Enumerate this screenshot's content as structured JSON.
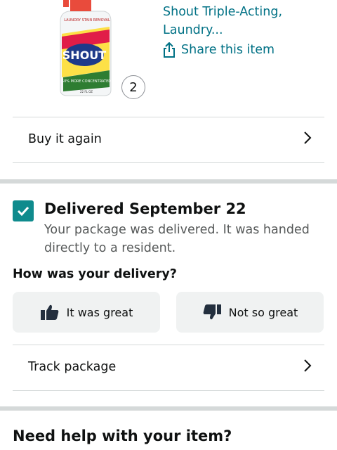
{
  "product": {
    "title": "Shout Triple-Acting, Laundry...",
    "share_label": "Share this item",
    "quantity": "2",
    "image_icon": "shout-bottle-image",
    "image_text": [
      "LAUNDRY STAIN REMOVAL",
      "SHOUT",
      "50% MORE CONCENTRATED",
      "22 FL OZ"
    ]
  },
  "actions": {
    "buy_again": "Buy it again",
    "track_package": "Track package"
  },
  "delivery": {
    "title": "Delivered September 22",
    "description": "Your package was delivered. It was handed directly to a resident.",
    "question": "How was your delivery?",
    "great_label": "It was great",
    "not_great_label": "Not so great"
  },
  "help": {
    "title": "Need help with your item?"
  },
  "colors": {
    "link": "#007185",
    "check": "#0f8b8d",
    "thumb": "#232f3e"
  }
}
